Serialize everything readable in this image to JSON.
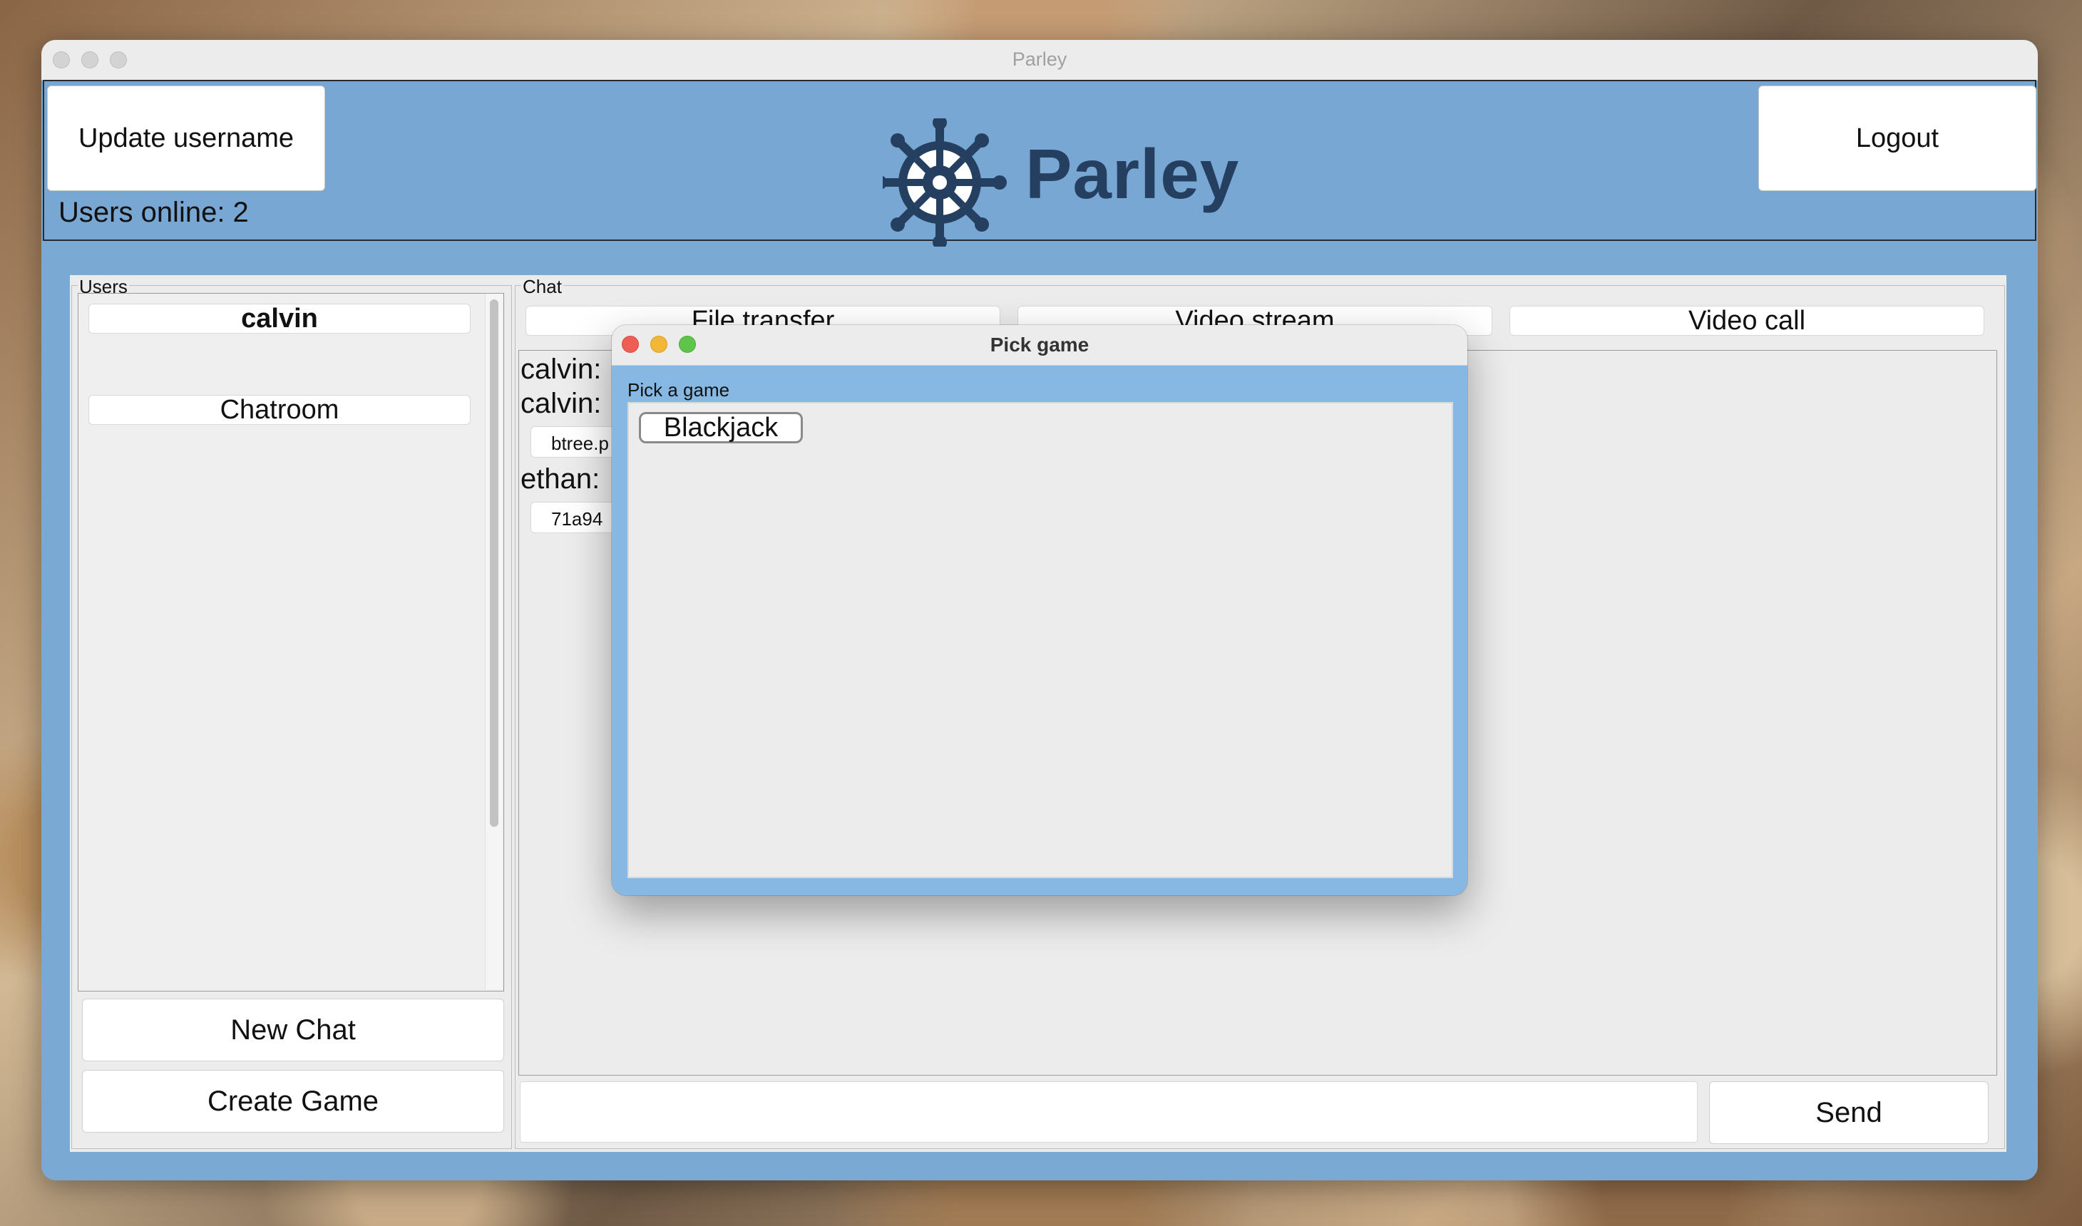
{
  "window": {
    "title": "Parley"
  },
  "header": {
    "update_username_label": "Update username",
    "logout_label": "Logout",
    "users_online": "Users online: 2",
    "logo_text": "Parley"
  },
  "users_panel": {
    "label": "Users",
    "items": [
      {
        "label": "calvin",
        "bold": true
      },
      {
        "label": "Chatroom",
        "bold": false
      }
    ],
    "new_chat_label": "New Chat",
    "create_game_label": "Create Game"
  },
  "chat_panel": {
    "label": "Chat",
    "tabs": [
      "File transfer",
      "Video stream",
      "Video call"
    ],
    "messages": [
      {
        "sender": "calvin:"
      },
      {
        "sender": "calvin:",
        "file": "btree.p"
      },
      {
        "sender": "ethan:",
        "file": "71a94"
      }
    ],
    "input_value": "",
    "send_label": "Send"
  },
  "dialog": {
    "title": "Pick game",
    "label": "Pick a game",
    "games": [
      "Blackjack"
    ]
  },
  "colors": {
    "accent": "#7aaad3",
    "dialog_bg": "#86b8e3",
    "logo": "#243f5f",
    "close": "#ee5e55",
    "minimize": "#f3b637",
    "zoom": "#5ec54a"
  }
}
